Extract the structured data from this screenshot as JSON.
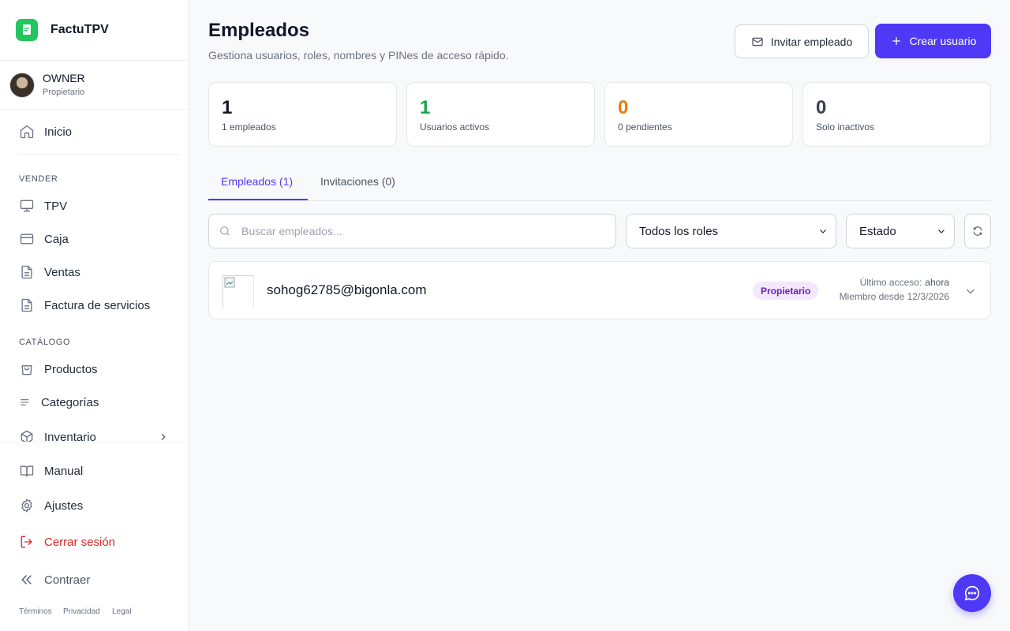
{
  "app": {
    "name": "FactuTPV",
    "logo_color": "#22c55e",
    "accent": "#4f39f6"
  },
  "user": {
    "name": "OWNER",
    "role": "Propietario"
  },
  "sidebar": {
    "home": "Inicio",
    "section_sell": "VENDER",
    "sell_items": [
      "TPV",
      "Caja",
      "Ventas",
      "Factura de servicios"
    ],
    "section_catalog": "CATÁLOGO",
    "catalog_items": [
      "Productos",
      "Categorías",
      "Inventario"
    ],
    "manual": "Manual",
    "settings": "Ajustes",
    "logout": "Cerrar sesión",
    "collapse": "Contraer",
    "legal": [
      "Términos",
      "Privacidad",
      "Legal"
    ]
  },
  "header": {
    "title": "Empleados",
    "subtitle": "Gestiona usuarios, roles, nombres y PINes de acceso rápido.",
    "invite_label": "Invitar empleado",
    "create_label": "Crear usuario"
  },
  "stats": [
    {
      "value": "1",
      "label": "1 empleados",
      "color": "#111827"
    },
    {
      "value": "1",
      "label": "Usuarios activos",
      "color": "#16a34a"
    },
    {
      "value": "0",
      "label": "0 pendientes",
      "color": "#ea7a0c"
    },
    {
      "value": "0",
      "label": "Solo inactivos",
      "color": "#374151"
    }
  ],
  "tabs": [
    {
      "label": "Empleados (1)",
      "active": true
    },
    {
      "label": "Invitaciones (0)",
      "active": false
    }
  ],
  "filters": {
    "search_placeholder": "Buscar empleados...",
    "role_selected": "Todos los roles",
    "status_selected": "Estado"
  },
  "employees": [
    {
      "email": "sohog62785@bigonla.com",
      "role_badge": "Propietario",
      "last_access_label": "Último acceso:",
      "last_access_value": "ahora",
      "member_since": "Miembro desde 12/3/2026"
    }
  ]
}
